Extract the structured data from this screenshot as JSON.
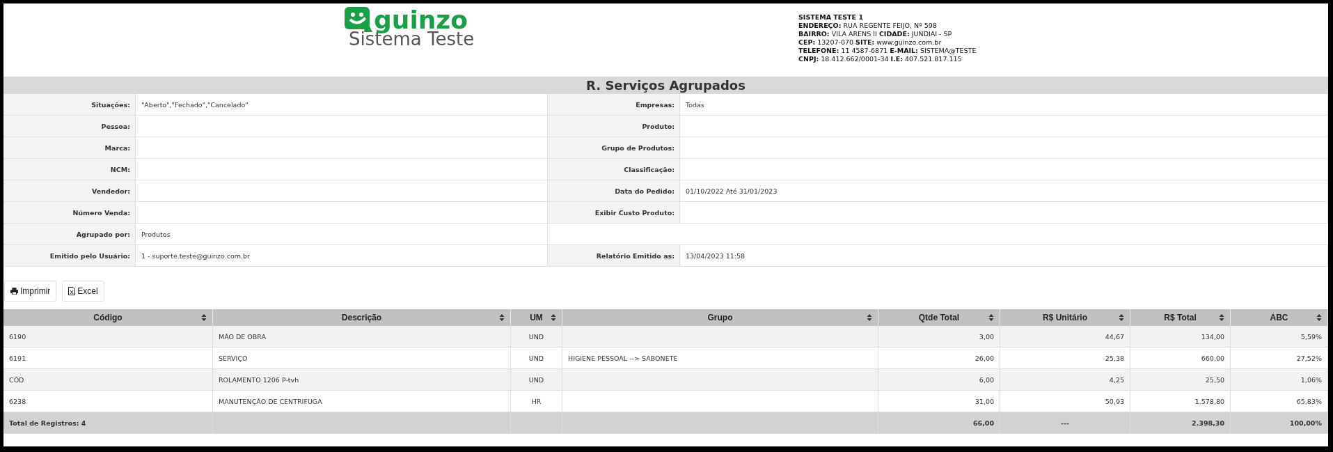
{
  "logo": {
    "brand": "guinzo",
    "subtitle": "Sistema Teste"
  },
  "company": [
    "**SISTEMA TESTE 1**",
    "**ENDEREÇO:** RUA REGENTE FEIJO, Nº 598",
    "**BAIRRO:** VILA ARENS II **CIDADE:** JUNDIAI - SP",
    "**CEP:** 13207-070 **SITE:** www.guinzo.com.br",
    "**TELEFONE:** 11 4587-6871 **E-MAIL:** SISTEMA@TESTE",
    "**CNPJ:** 18.412.662/0001-34 **I.E:** 407.521.817.115"
  ],
  "report_title": "R. Serviços Agrupados",
  "filters": [
    {
      "left": {
        "label": "Situações:",
        "value": "\"Aberto\",\"Fechado\",\"Cancelado\""
      },
      "right": {
        "label": "Empresas:",
        "value": "Todas"
      }
    },
    {
      "left": {
        "label": "Pessoa:"
      },
      "right": {
        "label": "Produto:"
      }
    },
    {
      "left": {
        "label": "Marca:"
      },
      "right": {
        "label": "Grupo de Produtos:"
      }
    },
    {
      "left": {
        "label": "NCM:"
      },
      "right": {
        "label": "Classificação:"
      }
    },
    {
      "left": {
        "label": "Vendedor:"
      },
      "right": {
        "label": "Data do Pedido:",
        "value": "01/10/2022 Até 31/01/2023"
      }
    },
    {
      "left": {
        "label": "Número Venda:"
      },
      "right": {
        "label": "Exibir Custo Produto:"
      }
    },
    {
      "left": {
        "label": "Agrupado por:",
        "value": "Produtos"
      }
    },
    {
      "left": {
        "label": "Emitido pelo Usuário:",
        "value": "1 - suporte.teste@guinzo.com.br"
      },
      "right": {
        "label": "Relatório Emitido as:",
        "value": "13/04/2023 11:58"
      }
    }
  ],
  "buttons": [
    {
      "kind": "print",
      "label": "Imprimir"
    },
    {
      "kind": "excel",
      "label": "Excel"
    }
  ],
  "table": {
    "columns": [
      "Código",
      "Descrição",
      "UM",
      "Grupo",
      "Qtde Total",
      "R$ Unitário",
      "R$ Total",
      "ABC"
    ],
    "rows": [
      [
        "6190",
        "MÃO DE OBRA",
        "UND",
        null,
        "3,00",
        "44,67",
        "134,00",
        "5,59%"
      ],
      [
        "6191",
        "SERVIÇO",
        "UND",
        "HIGIENE PESSOAL --> SABONETE",
        "26,00",
        "25,38",
        "660,00",
        "27,52%"
      ],
      [
        "CÓD",
        "ROLAMENTO 1206 P-tvh",
        "UND",
        null,
        "6,00",
        "4,25",
        "25,50",
        "1,06%"
      ],
      [
        "6238",
        "MANUTENÇÃO DE CENTRIFUGA",
        "HR",
        null,
        "31,00",
        "50,93",
        "1.578,80",
        "65,83%"
      ]
    ],
    "footer": {
      "label": "Total de Registros: 4",
      "qtde_total": "66,00",
      "unit_price": "---",
      "total": "2.398,30",
      "abc": "100,00%"
    }
  }
}
